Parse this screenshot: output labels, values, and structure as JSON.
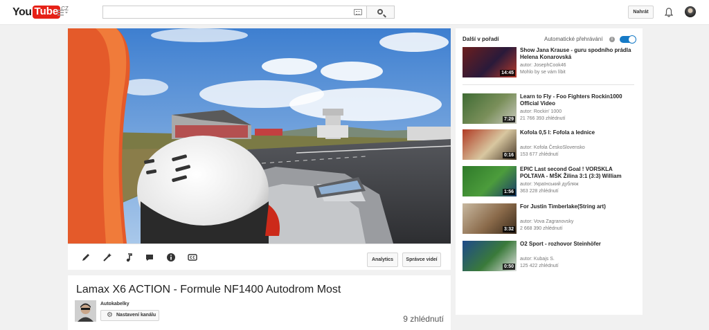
{
  "header": {
    "logo_you": "You",
    "logo_tube": "Tube",
    "logo_country": "CZ",
    "upload_label": "Nahrát"
  },
  "player": {
    "tools": [
      "pencil-icon",
      "magic-wand-icon",
      "music-note-icon",
      "comment-icon",
      "info-icon",
      "cc-icon"
    ],
    "analytics_label": "Analytics",
    "manager_label": "Správce videí"
  },
  "video": {
    "title": "Lamax X6 ACTION - Formule NF1400 Autodrom Most",
    "channel": "Autokabelky",
    "channel_settings_label": "Nastavení kanálu",
    "views": "9 zhlédnutí"
  },
  "sidebar": {
    "up_next_label": "Další v pořadí",
    "autoplay_label": "Automatické přehrávání",
    "autoplay_on": true,
    "items": [
      {
        "title": "Show Jana Krause - guru spodního prádla Helena Konarovská",
        "author": "autor: JosephCook46",
        "meta": "Mohlo by se vám líbit",
        "duration": "14:45",
        "colors": [
          "#6b1e1e",
          "#2a1a3a",
          "#b83a2a"
        ]
      },
      {
        "title": "Learn to Fly - Foo Fighters Rockin1000 Official Video",
        "author": "autor: Rockin' 1000",
        "meta": "21 766 393 zhlédnutí",
        "duration": "7:29",
        "colors": [
          "#3f6b34",
          "#7a8f5a",
          "#c9c9c0"
        ]
      },
      {
        "title": "Kofola 0,5 l: Fofola a lednice",
        "author": "autor: Kofola ČeskoSlovensko",
        "meta": "153 677 zhlédnutí",
        "duration": "0:16",
        "colors": [
          "#b03a24",
          "#d8c7a0",
          "#4a3a2a"
        ]
      },
      {
        "title": "EPIC Last second Goal ! VORSKLA POLTAVA - MŠK Žilina 3:1 (3:3) William",
        "author": "autor: Український дубляж",
        "meta": "363 228 zhlédnutí",
        "duration": "1:56",
        "colors": [
          "#2f7a2a",
          "#4c9c3c",
          "#1a3a6a"
        ]
      },
      {
        "title": "For Justin Timberlake(String art)",
        "author": "autor: Vova Zagranovsky",
        "meta": "2 668 390 zhlédnutí",
        "duration": "3:32",
        "colors": [
          "#c8b8a0",
          "#8a6a4a",
          "#3a2a1a"
        ]
      },
      {
        "title": "O2 Sport - rozhovor Steinhöfer",
        "author": "autor: Kubajs S.",
        "meta": "125 422 zhlédnutí",
        "duration": "0:50",
        "colors": [
          "#1e4a8a",
          "#3a7a3a",
          "#e0e0e0"
        ]
      }
    ]
  }
}
